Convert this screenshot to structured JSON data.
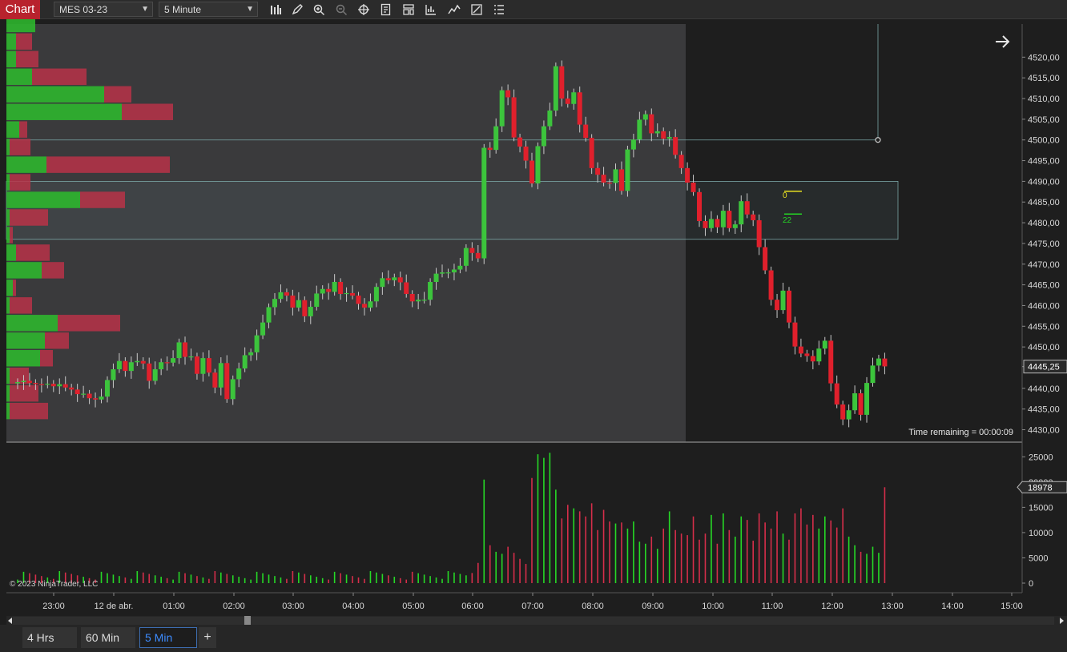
{
  "toolbar": {
    "chart_tab_label": "Chart",
    "instrument": "MES 03-23",
    "interval": "5 Minute",
    "tools": [
      "bar-type-icon",
      "pencil-icon",
      "zoom-in-icon",
      "zoom-out-icon",
      "crosshair-icon",
      "properties-icon",
      "template-icon",
      "strategy-icon",
      "indicator-icon",
      "drawing-tools-icon",
      "object-list-icon"
    ]
  },
  "price_axis": {
    "labels": [
      "4520,00",
      "4515,00",
      "4510,00",
      "4505,00",
      "4500,00",
      "4495,00",
      "4490,00",
      "4485,00",
      "4480,00",
      "4475,00",
      "4470,00",
      "4465,00",
      "4460,00",
      "4455,00",
      "4450,00",
      "4445,25",
      "4440,00",
      "4435,00",
      "4430,00"
    ],
    "current_price": "4445,25",
    "ylim": [
      4427,
      4528
    ]
  },
  "volume_axis": {
    "labels": [
      "25000",
      "20000",
      "15000",
      "10000",
      "5000",
      "0"
    ],
    "current_volume": "18978"
  },
  "time_axis": {
    "labels": [
      "23:00",
      "12 de abr.",
      "01:00",
      "02:00",
      "03:00",
      "04:00",
      "05:00",
      "06:00",
      "07:00",
      "08:00",
      "09:00",
      "10:00",
      "11:00",
      "12:00",
      "13:00",
      "14:00",
      "15:00"
    ]
  },
  "overlay": {
    "time_remaining": "Time remaining = 00:00:09",
    "copyright": "© 2023 NinjaTrader, LLC",
    "marker_yellow": "0",
    "marker_green": "22"
  },
  "bottom_tabs": [
    "4 Hrs",
    "60 Min",
    "5 Min"
  ],
  "bottom_add": "+",
  "colors": {
    "up": "#3cc43c",
    "down": "#e0202c",
    "up_volume": "#26d926",
    "down_volume": "#d62e4a",
    "accent": "#b8222d",
    "tab_active": "#3d8cff"
  },
  "chart_data": {
    "type": "candlestick",
    "candles_close": [
      4441.5,
      4441.8,
      4441.3,
      4441.0,
      4440.9,
      4441.1,
      4440.5,
      4441.0,
      4440.2,
      4439.7,
      4438.6,
      4438.7,
      4437.6,
      4437.3,
      4438.0,
      4442.0,
      4444.6,
      4446.6,
      4444.2,
      4446.3,
      4446.6,
      4446.0,
      4441.8,
      4444.6,
      4446.3,
      4446.2,
      4447.3,
      4451.1,
      4447.6,
      4447.7,
      4443.5,
      4447.3,
      4443.8,
      4440.2,
      4446.1,
      4437.4,
      4442.2,
      4444.8,
      4448.0,
      4448.7,
      4452.8,
      4455.9,
      4459.6,
      4461.6,
      4463.2,
      4462.4,
      4459.5,
      4461.3,
      4457.4,
      4459.7,
      4462.9,
      4464.0,
      4463.3,
      4465.7,
      4462.8,
      4463.0,
      4462.4,
      4460.4,
      4459.5,
      4461.0,
      4464.5,
      4466.6,
      4466.1,
      4466.8,
      4465.6,
      4462.8,
      4461.0,
      4461.4,
      4461.4,
      4465.7,
      4467.7,
      4468.0,
      4468.0,
      4468.7,
      4469.6,
      4473.9,
      4472.7,
      4471.4,
      4498.1,
      4497.6,
      4503.3,
      4512.0,
      4510.3,
      4500.6,
      4498.4,
      4495.0,
      4489.5,
      4498.5,
      4503.3,
      4507.1,
      4517.8,
      4510.0,
      4508.7,
      4511.5,
      4503.7,
      4500.5,
      4493.2,
      4491.6,
      4489.7,
      4489.6,
      4492.9,
      4487.7,
      4497.7,
      4500.1,
      4504.9,
      4506.2,
      4501.6,
      4502.1,
      4500.3,
      4500.7,
      4496.4,
      4493.2,
      4489.7,
      4487.4,
      4480.4,
      4478.7,
      4480.9,
      4478.9,
      4482.9,
      4478.7,
      4479.6,
      4485.2,
      4482.0,
      4480.6,
      4474.1,
      4468.5,
      4461.4,
      4458.9,
      4463.6,
      4455.9,
      4450.1,
      4448.4,
      4447.8,
      4446.5,
      4449.6,
      4451.5,
      4441.2,
      4436.1,
      4432.5,
      4434.7,
      4438.8,
      4433.6,
      4441.3,
      4445.5,
      4447.2,
      4445.3
    ],
    "volume_profile_levels": 24,
    "volume_series": "up/down volume bars under price panel"
  }
}
